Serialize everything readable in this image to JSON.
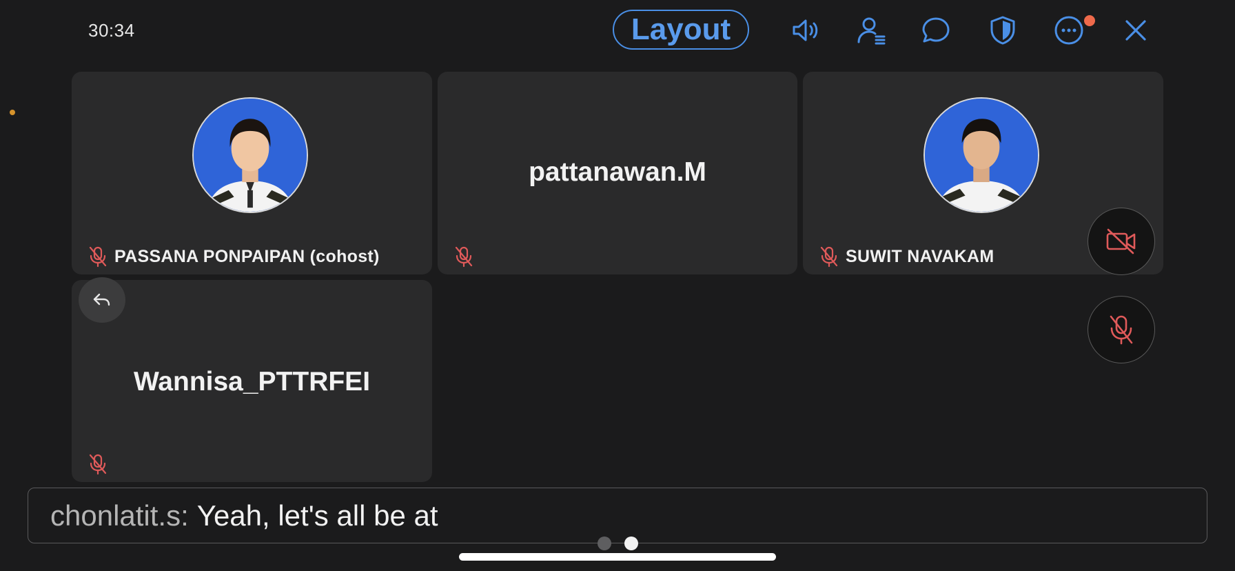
{
  "header": {
    "timer": "30:34",
    "layout_label": "Layout",
    "icons": [
      "speaker-icon",
      "participants-icon",
      "chat-icon",
      "security-shield-icon",
      "more-icon",
      "close-icon"
    ],
    "more_badge_color": "#ef6a4b",
    "accent_color": "#4a8fe6"
  },
  "tiles": [
    {
      "name": "PASSANA PONPAIPAN (cohost)",
      "has_photo": true,
      "muted": true
    },
    {
      "center_name": "pattanawan.M",
      "muted": true
    },
    {
      "name": "SUWIT NAVAKAM",
      "has_photo": true,
      "muted": true
    },
    {
      "center_name": "Wannisa_PTTRFEI",
      "muted": true
    }
  ],
  "controls": {
    "video_off_icon": "video-off-icon",
    "mic_muted_icon": "mic-muted-icon",
    "back_icon": "reply-arrow-icon",
    "muted_color": "#e05a5a"
  },
  "caption": {
    "sender": "chonlatit.s:",
    "message": "Yeah, let's all be at"
  },
  "pager": {
    "pages": 2,
    "current": 2
  }
}
